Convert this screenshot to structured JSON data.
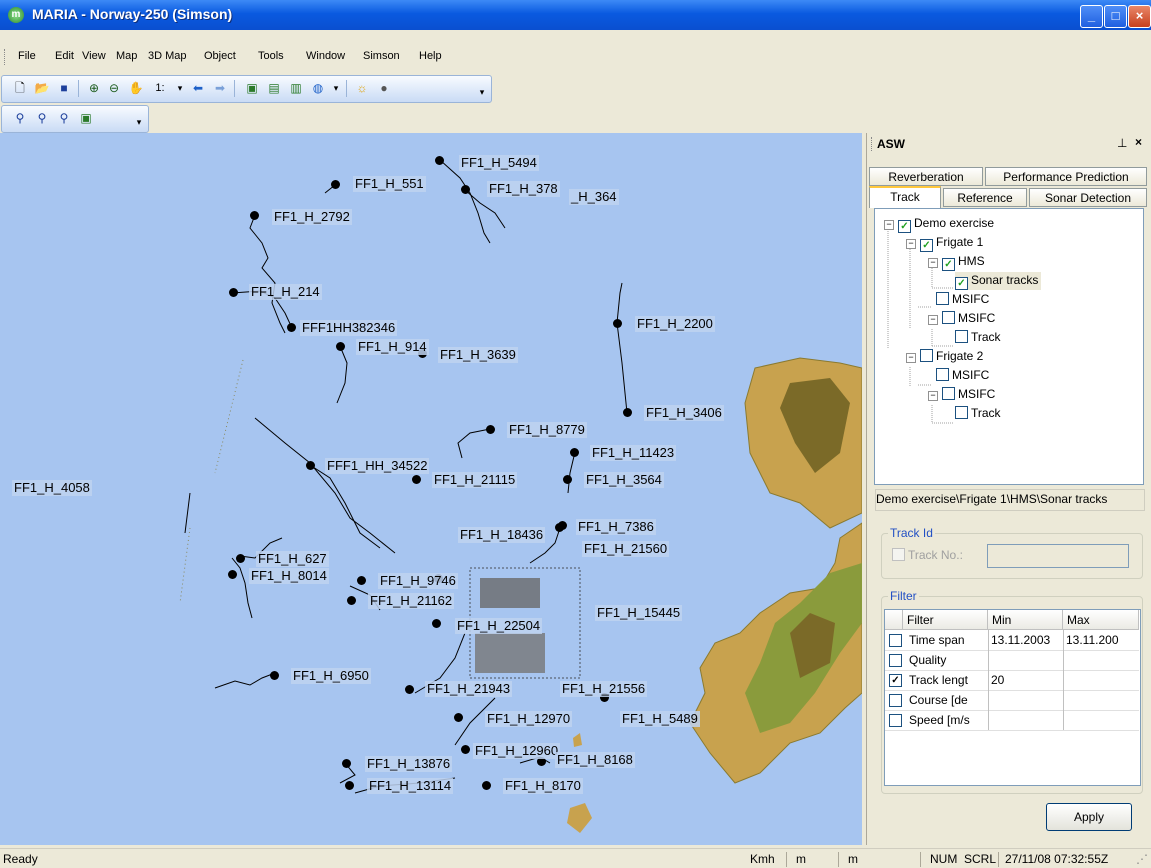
{
  "window": {
    "title": "MARIA - Norway-250 (Simson)"
  },
  "menu": [
    "File",
    "Edit",
    "View",
    "Map",
    "3D Map",
    "Object",
    "Tools",
    "Window",
    "Simson",
    "Help"
  ],
  "toolbar": {
    "scale_label": "1:"
  },
  "map": {
    "labels": [
      {
        "t": "FF1_H_5494"
      },
      {
        "t": "FF1_H_551"
      },
      {
        "t": "FF1_H_378"
      },
      {
        "t": "_H_364"
      },
      {
        "t": "FF1_H_2792"
      },
      {
        "t": "FF1_H_214"
      },
      {
        "t": "FFF1HH382346"
      },
      {
        "t": "FF1_H_914"
      },
      {
        "t": "FF1_H_3639"
      },
      {
        "t": "FF1_H_2200"
      },
      {
        "t": "FF1_H_3406"
      },
      {
        "t": "FF1_H_8779"
      },
      {
        "t": "FF1_H_11423"
      },
      {
        "t": "FFF1_HH_34522"
      },
      {
        "t": "FF1_H_21115"
      },
      {
        "t": "FF1_H_3564"
      },
      {
        "t": "FF1_H_4058"
      },
      {
        "t": "FF1_H_18436"
      },
      {
        "t": "FF1_H_7386"
      },
      {
        "t": "FF1_H_21560"
      },
      {
        "t": "FF1_H_627"
      },
      {
        "t": "FF1_H_8014"
      },
      {
        "t": "FF1_H_9746"
      },
      {
        "t": "FF1_H_21162"
      },
      {
        "t": "FF1_H_15445"
      },
      {
        "t": "FF1_H_22504"
      },
      {
        "t": "FF1_H_6950"
      },
      {
        "t": "FF1_H_21943"
      },
      {
        "t": "FF1_H_21556"
      },
      {
        "t": "FF1_H_12970"
      },
      {
        "t": "FF1_H_5489"
      },
      {
        "t": "FF1_H_12960"
      },
      {
        "t": "FF1_H_13876"
      },
      {
        "t": "FF1_H_8168"
      },
      {
        "t": "FF1_H_13114"
      },
      {
        "t": "FF1_H_8170"
      }
    ]
  },
  "panel": {
    "title": "ASW",
    "tabs_row1": [
      "Reverberation",
      "Performance Prediction"
    ],
    "tabs_row2": [
      "Track",
      "Reference",
      "Sonar Detection"
    ],
    "tree": [
      {
        "label": "Demo exercise",
        "checked": true
      },
      {
        "label": "Frigate 1",
        "checked": true
      },
      {
        "label": "HMS",
        "checked": true
      },
      {
        "label": "Sonar tracks",
        "checked": true
      },
      {
        "label": "MSIFC",
        "checked": false
      },
      {
        "label": "MSIFC",
        "checked": false
      },
      {
        "label": "Track",
        "checked": false
      },
      {
        "label": "Frigate 2",
        "checked": false
      },
      {
        "label": "MSIFC",
        "checked": false
      },
      {
        "label": "MSIFC",
        "checked": false
      },
      {
        "label": "Track",
        "checked": false
      }
    ],
    "path": "Demo exercise\\Frigate 1\\HMS\\Sonar tracks",
    "track_id": {
      "group": "Track Id",
      "label": "Track No.:",
      "value": ""
    },
    "filter": {
      "group": "Filter",
      "headers": [
        "Filter",
        "Min",
        "Max"
      ],
      "rows": [
        {
          "name": "Time span",
          "checked": false,
          "min": "13.11.2003",
          "max": "13.11.200"
        },
        {
          "name": "Quality",
          "checked": false,
          "min": "",
          "max": ""
        },
        {
          "name": "Track lengt",
          "checked": true,
          "min": "20",
          "max": ""
        },
        {
          "name": "Course [de",
          "checked": false,
          "min": "",
          "max": ""
        },
        {
          "name": "Speed [m/s",
          "checked": false,
          "min": "",
          "max": ""
        }
      ]
    },
    "apply_label": "Apply"
  },
  "status": {
    "left": "Ready",
    "kmh": "Kmh",
    "m1": "m",
    "m2": "m",
    "num": "NUM",
    "scrl": "SCRL",
    "datetime": "27/11/08  07:32:55Z"
  },
  "colors": {
    "sea": "#a7c5f0",
    "land_low": "#c8a24e",
    "land_high": "#7b6a28",
    "land_green": "#8a9b3c"
  }
}
